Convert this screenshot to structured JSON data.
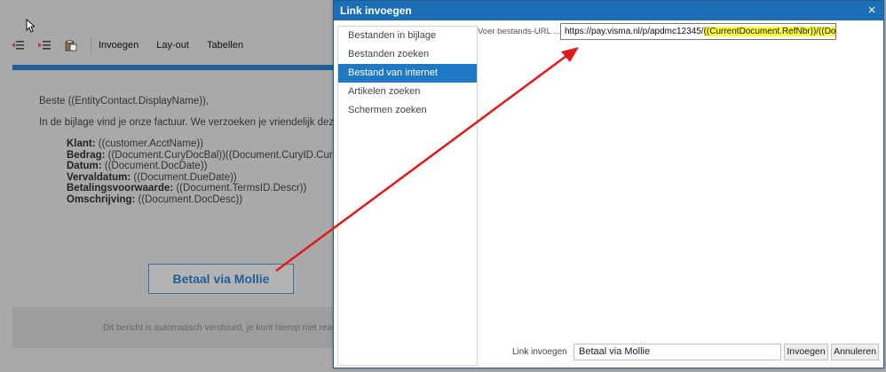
{
  "editor": {
    "toolbar": {
      "items": [
        "Invoegen",
        "Lay-out",
        "Tabellen"
      ]
    },
    "letter": {
      "greeting": "Beste ((EntityContact.DisplayName)),",
      "intro": "In de bijlage vind je onze factuur. We verzoeken je vriendelijk deze te",
      "fields": [
        {
          "label": "Klant:",
          "value": " ((customer.AcctName))"
        },
        {
          "label": "Bedrag:",
          "value": " ((Document.CuryDocBal))((Document.CuryID.CuryID"
        },
        {
          "label": "Datum:",
          "value": " ((Document.DocDate))"
        },
        {
          "label": "Vervaldatum:",
          "value": " ((Document.DueDate))"
        },
        {
          "label": "Betalingsvoorwaarde:",
          "value": " ((Document.TermsID.Descr))"
        },
        {
          "label": "Omschrijving:",
          "value": " ((Document.DocDesc))"
        }
      ]
    },
    "pay_button": "Betaal via Mollie",
    "footer_text": "Dit bericht is automatisch verstuurd, je kunt hierop niet reageren"
  },
  "dialog": {
    "title": "Link invoegen",
    "close": "×",
    "sidebar": [
      {
        "label": "Bestanden in bijlage",
        "active": false
      },
      {
        "label": "Bestanden zoeken",
        "active": false
      },
      {
        "label": "Bestand van internet",
        "active": true
      },
      {
        "label": "Artikelen zoeken",
        "active": false
      },
      {
        "label": "Schermen zoeken",
        "active": false
      }
    ],
    "url_label": "Voer bestands-URL ...",
    "url_plain": "https://pay.visma.nl/p/apdmc12345/",
    "url_highlight": "((CurrentDocument.RefNbr))/((Document",
    "link_label": "Link invoegen",
    "link_value": "Betaal via Mollie",
    "insert_button": "Invoegen",
    "cancel_button": "Annuleren"
  },
  "colors": {
    "accent": "#1c6fb5",
    "highlight": "#ffff3a",
    "arrow": "#e01a1a"
  }
}
